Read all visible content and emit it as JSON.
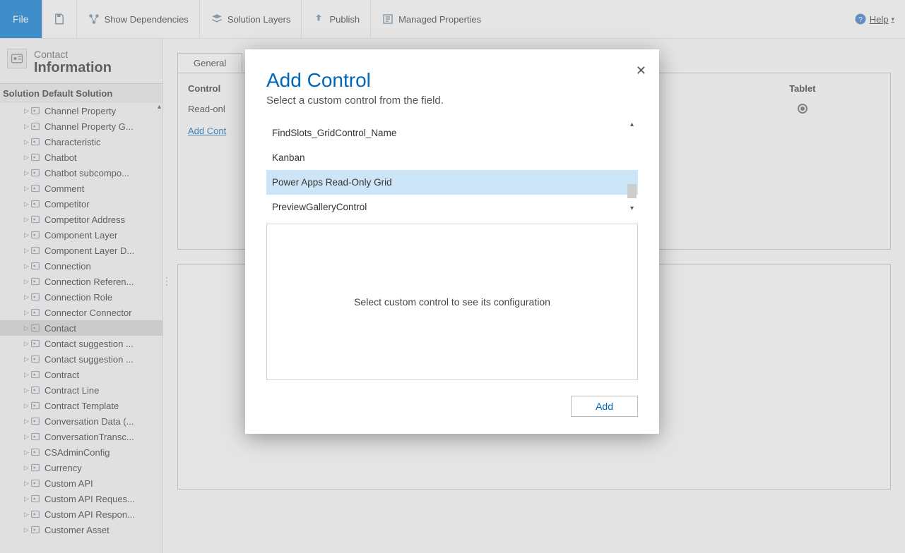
{
  "toolbar": {
    "file": "File",
    "show_deps": "Show Dependencies",
    "solution_layers": "Solution Layers",
    "publish": "Publish",
    "managed_props": "Managed Properties",
    "help": "Help"
  },
  "header": {
    "entity": "Contact",
    "title": "Information"
  },
  "solution_label": "Solution Default Solution",
  "tree": [
    {
      "label": "Channel Property",
      "sel": false
    },
    {
      "label": "Channel Property G...",
      "sel": false
    },
    {
      "label": "Characteristic",
      "sel": false
    },
    {
      "label": "Chatbot",
      "sel": false
    },
    {
      "label": "Chatbot subcompo...",
      "sel": false
    },
    {
      "label": "Comment",
      "sel": false
    },
    {
      "label": "Competitor",
      "sel": false
    },
    {
      "label": "Competitor Address",
      "sel": false
    },
    {
      "label": "Component Layer",
      "sel": false
    },
    {
      "label": "Component Layer D...",
      "sel": false
    },
    {
      "label": "Connection",
      "sel": false
    },
    {
      "label": "Connection Referen...",
      "sel": false
    },
    {
      "label": "Connection Role",
      "sel": false
    },
    {
      "label": "Connector Connector",
      "sel": false
    },
    {
      "label": "Contact",
      "sel": true
    },
    {
      "label": "Contact suggestion ...",
      "sel": false
    },
    {
      "label": "Contact suggestion ...",
      "sel": false
    },
    {
      "label": "Contract",
      "sel": false
    },
    {
      "label": "Contract Line",
      "sel": false
    },
    {
      "label": "Contract Template",
      "sel": false
    },
    {
      "label": "Conversation Data (...",
      "sel": false
    },
    {
      "label": "ConversationTransc...",
      "sel": false
    },
    {
      "label": "CSAdminConfig",
      "sel": false
    },
    {
      "label": "Currency",
      "sel": false
    },
    {
      "label": "Custom API",
      "sel": false
    },
    {
      "label": "Custom API Reques...",
      "sel": false
    },
    {
      "label": "Custom API Respon...",
      "sel": false
    },
    {
      "label": "Customer Asset",
      "sel": false
    }
  ],
  "content": {
    "tab_general": "General",
    "col_control": "Control",
    "col_tablet": "Tablet",
    "row_readonly": "Read-onl",
    "add_control": "Add Cont"
  },
  "modal": {
    "title": "Add Control",
    "subtitle": "Select a custom control from the field.",
    "items": [
      "FindSlots_GridControl_Name",
      "Kanban",
      "Power Apps Read-Only Grid",
      "PreviewGalleryControl"
    ],
    "selected_index": 2,
    "config_placeholder": "Select custom control to see its configuration",
    "add_btn": "Add"
  }
}
